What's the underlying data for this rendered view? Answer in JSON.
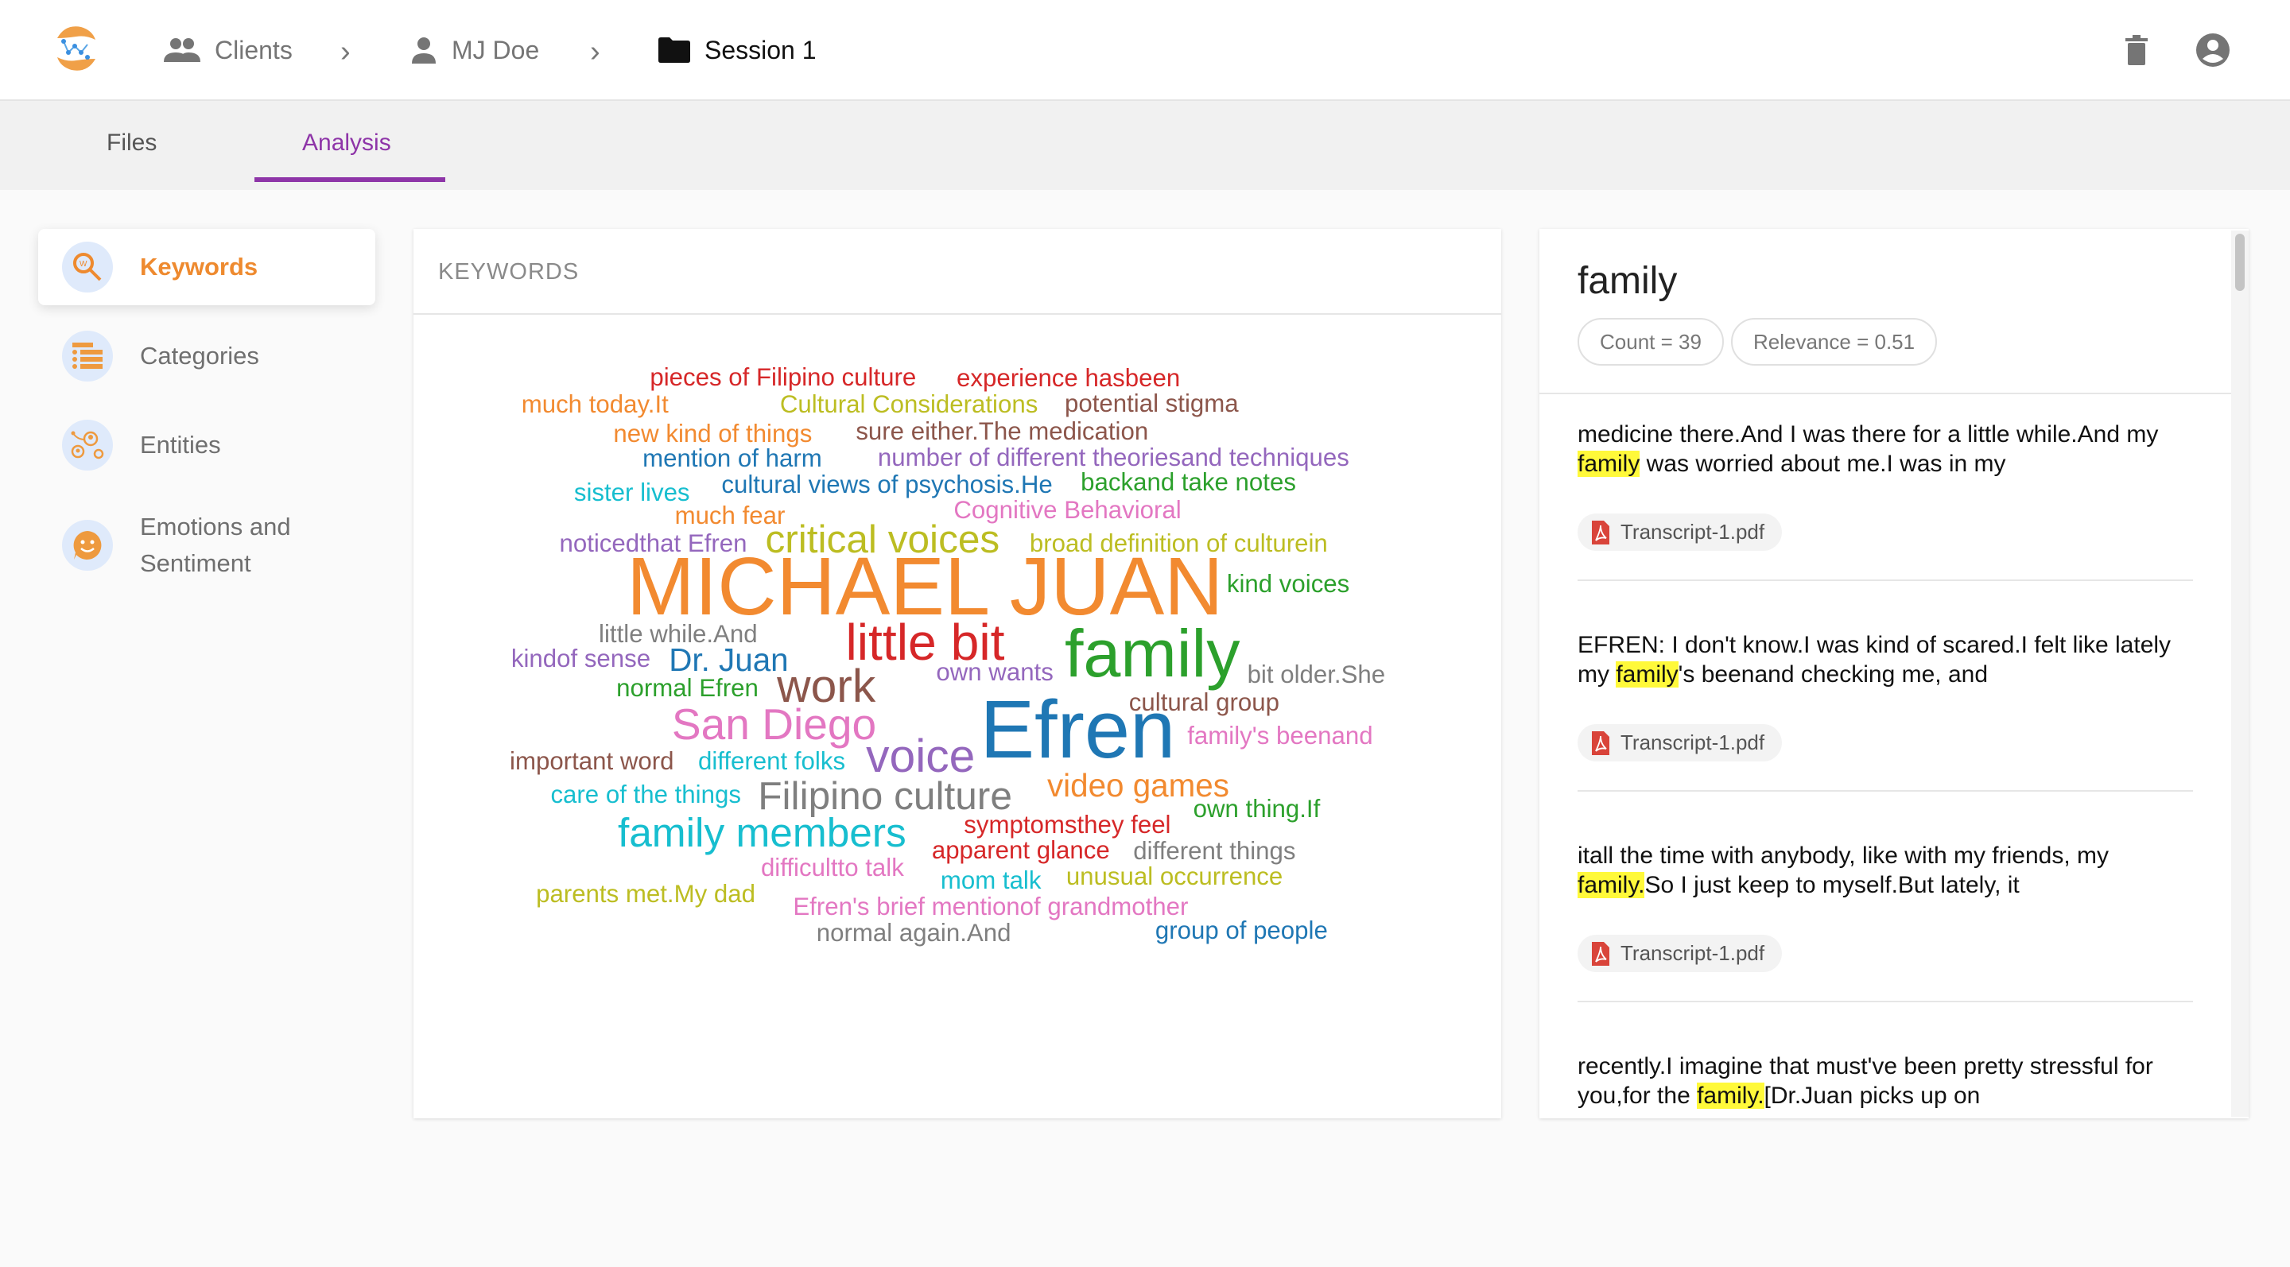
{
  "header": {
    "breadcrumb": [
      {
        "label": "Clients",
        "icon": "people-icon"
      },
      {
        "label": "MJ Doe",
        "icon": "person-icon"
      },
      {
        "label": "Session 1",
        "icon": "folder-icon"
      }
    ]
  },
  "tabs": [
    {
      "label": "Files",
      "active": false
    },
    {
      "label": "Analysis",
      "active": true
    }
  ],
  "sidebar": {
    "items": [
      {
        "label": "Keywords",
        "icon": "keyword-search-icon",
        "active": true
      },
      {
        "label": "Categories",
        "icon": "list-icon",
        "active": false
      },
      {
        "label": "Entities",
        "icon": "entities-network-icon",
        "active": false
      },
      {
        "label": "Emotions and Sentiment",
        "icon": "smiley-icon",
        "active": false
      }
    ]
  },
  "keywords": {
    "title": "KEYWORDS",
    "words": [
      {
        "text": "pieces of Filipino culture",
        "color": "#d62728"
      },
      {
        "text": "experience hasbeen",
        "color": "#d62728"
      },
      {
        "text": "much today.It",
        "color": "#f28a30"
      },
      {
        "text": "Cultural Considerations",
        "color": "#bcbd22"
      },
      {
        "text": "potential stigma",
        "color": "#8c564b"
      },
      {
        "text": "new kind of things",
        "color": "#f28a30"
      },
      {
        "text": "sure either.The medication",
        "color": "#8c564b"
      },
      {
        "text": "mention of harm",
        "color": "#1f77b4"
      },
      {
        "text": "number of different theoriesand techniques",
        "color": "#9467bd"
      },
      {
        "text": "sister lives",
        "color": "#17becf"
      },
      {
        "text": "cultural views of psychosis.He",
        "color": "#1f77b4"
      },
      {
        "text": "backand take notes",
        "color": "#2ca02c"
      },
      {
        "text": "much fear",
        "color": "#f28a30"
      },
      {
        "text": "Cognitive Behavioral",
        "color": "#e377c2"
      },
      {
        "text": "noticedthat Efren",
        "color": "#9467bd"
      },
      {
        "text": "critical voices",
        "color": "#bcbd22"
      },
      {
        "text": "broad definition of culturein",
        "color": "#bcbd22"
      },
      {
        "text": "MICHAEL JUAN",
        "color": "#f28a30"
      },
      {
        "text": "kind voices",
        "color": "#2ca02c"
      },
      {
        "text": "little while.And",
        "color": "#7f7f7f"
      },
      {
        "text": "little bit",
        "color": "#d62728"
      },
      {
        "text": "family",
        "color": "#2ca02c"
      },
      {
        "text": "kindof sense",
        "color": "#9467bd"
      },
      {
        "text": "Dr. Juan",
        "color": "#1f77b4"
      },
      {
        "text": "own wants",
        "color": "#9467bd"
      },
      {
        "text": "bit older.She",
        "color": "#7f7f7f"
      },
      {
        "text": "normal Efren",
        "color": "#2ca02c"
      },
      {
        "text": "work",
        "color": "#8c564b"
      },
      {
        "text": "cultural group",
        "color": "#8c564b"
      },
      {
        "text": "San Diego",
        "color": "#e377c2"
      },
      {
        "text": "Efren",
        "color": "#1f77b4"
      },
      {
        "text": "family's beenand",
        "color": "#e377c2"
      },
      {
        "text": "important word",
        "color": "#8c564b"
      },
      {
        "text": "different folks",
        "color": "#17becf"
      },
      {
        "text": "voice",
        "color": "#9467bd"
      },
      {
        "text": "care of the things",
        "color": "#17becf"
      },
      {
        "text": "Filipino culture",
        "color": "#7f7f7f"
      },
      {
        "text": "video games",
        "color": "#f28a30"
      },
      {
        "text": "own thing.If",
        "color": "#2ca02c"
      },
      {
        "text": "family members",
        "color": "#17becf"
      },
      {
        "text": "symptomsthey feel",
        "color": "#d62728"
      },
      {
        "text": "apparent glance",
        "color": "#d62728"
      },
      {
        "text": "different things",
        "color": "#7f7f7f"
      },
      {
        "text": "difficultto talk",
        "color": "#e377c2"
      },
      {
        "text": "mom talk",
        "color": "#17becf"
      },
      {
        "text": "unusual occurrence",
        "color": "#bcbd22"
      },
      {
        "text": "parents met.My dad",
        "color": "#bcbd22"
      },
      {
        "text": "Efren's brief mentionof grandmother",
        "color": "#e377c2"
      },
      {
        "text": "normal again.And",
        "color": "#7f7f7f"
      },
      {
        "text": "group of people",
        "color": "#1f77b4"
      }
    ]
  },
  "detail": {
    "keyword": "family",
    "count_label": "Count = 39",
    "relevance_label": "Relevance = 0.51",
    "snippets": [
      {
        "before": "medicine there.And I was there for a little while.And my ",
        "highlight": "family",
        "after": " was worried about me.I was in my",
        "file": "Transcript-1.pdf"
      },
      {
        "before": "EFREN: I don't know.I was kind of scared.I felt like lately my ",
        "highlight": "family",
        "after": "'s beenand checking me, and",
        "file": "Transcript-1.pdf"
      },
      {
        "before": "itall the time with anybody, like with my friends, my ",
        "highlight": "family.",
        "after": "So I just keep to myself.But lately, it",
        "file": "Transcript-1.pdf"
      },
      {
        "before": "recently.I imagine that must've been pretty stressful for you,for the ",
        "highlight": "family.",
        "after": "[Dr.Juan picks up on",
        "file": ""
      }
    ]
  }
}
